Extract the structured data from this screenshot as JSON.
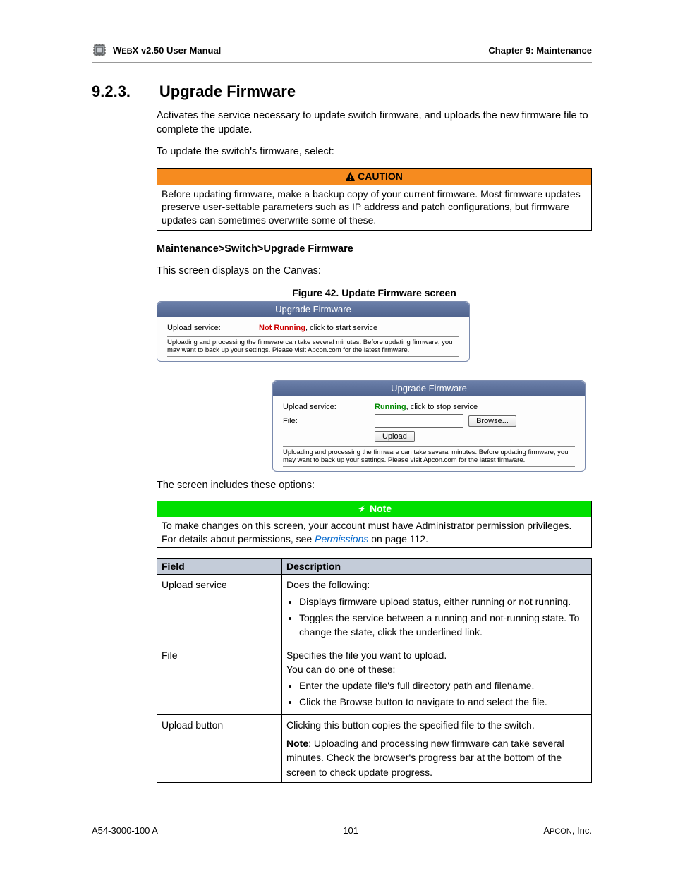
{
  "header": {
    "product_prefix": "W",
    "product_mid": "EB",
    "product_suffix": "X v2.50 User Manual",
    "chapter": "Chapter 9: Maintenance"
  },
  "section": {
    "number": "9.2.3.",
    "title": "Upgrade Firmware"
  },
  "intro": {
    "p1": "Activates the service necessary to update switch firmware, and uploads the new firmware file to complete the update.",
    "p2": "To update the switch's firmware, select:"
  },
  "caution": {
    "label": "CAUTION",
    "text": "Before updating firmware, make a backup copy of your current firmware. Most firmware updates preserve user-settable parameters such as IP address and patch configurations, but firmware updates can sometimes overwrite some of these."
  },
  "breadcrumb": "Maintenance>Switch>Upgrade Firmware",
  "canvas_line": "This screen displays on the Canvas:",
  "figure_caption": "Figure 42. Update Firmware screen",
  "panel": {
    "title": "Upgrade Firmware",
    "upload_label": "Upload service:",
    "file_label": "File:",
    "status_not_running": "Not Running",
    "status_running": "Running",
    "start_link": "click to start service",
    "stop_link": "click to stop service",
    "browse": "Browse...",
    "upload": "Upload",
    "hint_part1": "Uploading and processing the firmware can take several minutes. Before updating firmware, you may want to ",
    "hint_link1": "back up your settings",
    "hint_mid": ". Please visit ",
    "hint_link2": "Apcon.com",
    "hint_part2": " for the latest firmware."
  },
  "options_intro": "The screen includes these options:",
  "note": {
    "label": "Note",
    "text_part1": "To make changes on this screen, your account must have Administrator permission privileges. For details about permissions, see ",
    "link": "Permissions",
    "text_part2": " on page 112."
  },
  "table": {
    "col1": "Field",
    "col2": "Description",
    "rows": [
      {
        "field": "Upload service",
        "desc_intro": "Does the following:",
        "bullets": [
          "Displays firmware upload status, either running or not running.",
          "Toggles the service between a running and not-running state. To change the state, click the underlined link."
        ]
      },
      {
        "field": "File",
        "desc_intro": "Specifies the file you want to upload.",
        "desc_intro2": "You can do one of these:",
        "bullets": [
          "Enter the update file's full directory path and filename.",
          "Click the Browse button to navigate to and select the file."
        ]
      },
      {
        "field": "Upload button",
        "desc_intro": "Clicking this button copies the specified file to the switch.",
        "note_label": "Note",
        "note_text": ": Uploading and processing new firmware can take several minutes. Check the browser's progress bar at the bottom of the screen to check update progress."
      }
    ]
  },
  "footer": {
    "left": "A54-3000-100 A",
    "center": "101",
    "right_prefix": "A",
    "right_mid": "PCON",
    "right_suffix": ", Inc."
  }
}
